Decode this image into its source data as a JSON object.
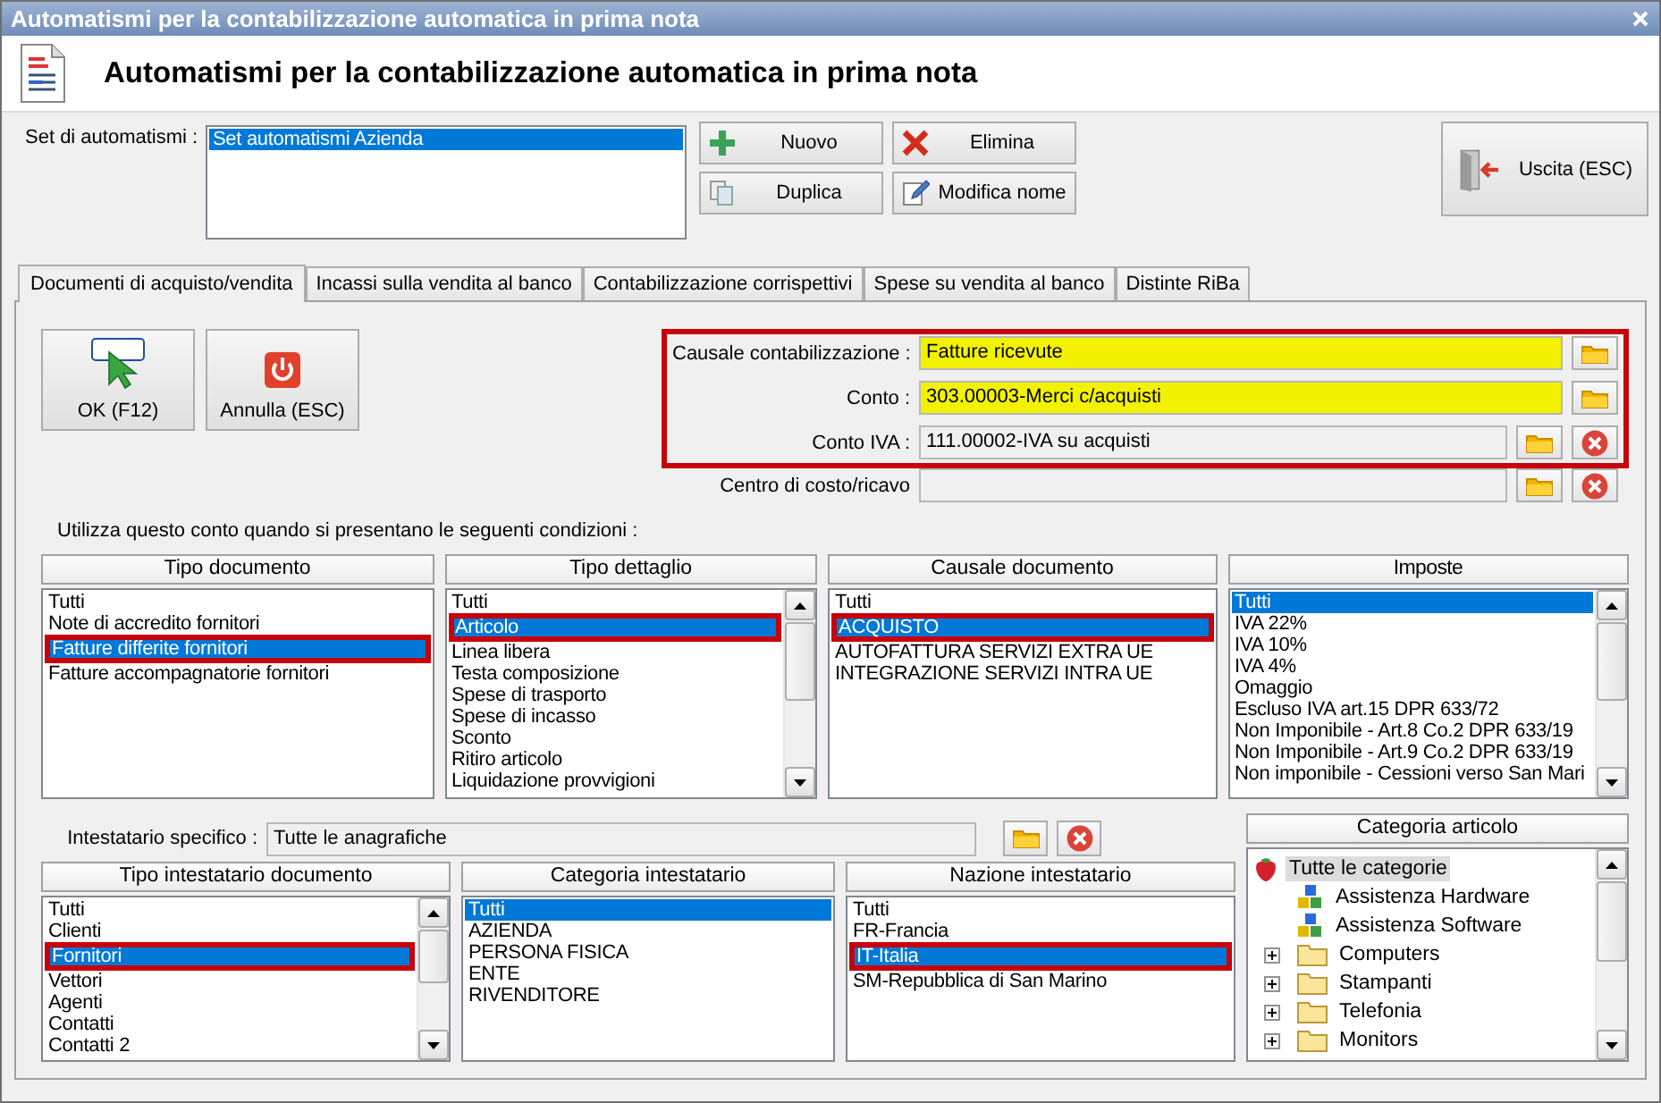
{
  "window": {
    "title": "Automatismi per la contabilizzazione automatica in prima nota"
  },
  "header": {
    "title": "Automatismi per la contabilizzazione automatica in prima nota"
  },
  "automation_sets": {
    "label": "Set di automatismi :",
    "items": [
      {
        "label": "Set automatismi Azienda",
        "selected": true
      }
    ]
  },
  "set_buttons": [
    "Nuovo",
    "Elimina",
    "Duplica",
    "Modifica nome"
  ],
  "exit_button": "Uscita (ESC)",
  "tabs": [
    {
      "label": "Documenti di acquisto/vendita",
      "selected": true
    },
    {
      "label": "Incassi sulla vendita al banco",
      "selected": false
    },
    {
      "label": "Contabilizzazione corrispettivi",
      "selected": false
    },
    {
      "label": "Spese su vendita al banco",
      "selected": false
    },
    {
      "label": "Distinte RiBa",
      "selected": false
    }
  ],
  "action_buttons": [
    "OK (F12)",
    "Annulla (ESC)"
  ],
  "account_fields": {
    "highlighted": true,
    "fields": [
      {
        "label": "Causale contabilizzazione :",
        "value": "Fatture ricevute",
        "required": true,
        "clearable": false
      },
      {
        "label": "Conto :",
        "value": "303.00003-Merci c/acquisti",
        "required": true,
        "clearable": false
      },
      {
        "label": "Conto IVA :",
        "value": "111.00002-IVA su acquisti",
        "required": false,
        "clearable": true
      }
    ]
  },
  "cost_center_field": {
    "label": "Centro di costo/ricavo",
    "required": false,
    "clearable": true
  },
  "conditions_label": "Utilizza questo conto quando si presentano le seguenti condizioni :",
  "condition_lists": [
    {
      "title": "Tipo documento",
      "scrollbar": false,
      "items": [
        {
          "label": "Tutti",
          "selected": false,
          "highlighted": false
        },
        {
          "label": "Note di accredito fornitori",
          "selected": false,
          "highlighted": false
        },
        {
          "label": "Fatture differite fornitori",
          "selected": true,
          "highlighted": true
        },
        {
          "label": "Fatture accompagnatorie fornitori",
          "selected": false,
          "highlighted": false
        }
      ]
    },
    {
      "title": "Tipo dettaglio",
      "scrollbar": true,
      "items": [
        {
          "label": "Tutti",
          "selected": false,
          "highlighted": false
        },
        {
          "label": "Articolo",
          "selected": true,
          "highlighted": true
        },
        {
          "label": "Linea libera",
          "selected": false,
          "highlighted": false
        },
        {
          "label": "Testa composizione",
          "selected": false,
          "highlighted": false
        },
        {
          "label": "Spese di trasporto",
          "selected": false,
          "highlighted": false
        },
        {
          "label": "Spese di incasso",
          "selected": false,
          "highlighted": false
        },
        {
          "label": "Sconto",
          "selected": false,
          "highlighted": false
        },
        {
          "label": "Ritiro articolo",
          "selected": false,
          "highlighted": false
        },
        {
          "label": "Liquidazione provvigioni",
          "selected": false,
          "highlighted": false
        }
      ]
    },
    {
      "title": "Causale documento",
      "scrollbar": false,
      "items": [
        {
          "label": "Tutti",
          "selected": false,
          "highlighted": false
        },
        {
          "label": "ACQUISTO",
          "selected": true,
          "highlighted": true
        },
        {
          "label": "AUTOFATTURA SERVIZI EXTRA UE",
          "selected": false,
          "highlighted": false
        },
        {
          "label": "INTEGRAZIONE SERVIZI INTRA UE",
          "selected": false,
          "highlighted": false
        }
      ]
    },
    {
      "title": "Imposte",
      "scrollbar": true,
      "items": [
        {
          "label": "Tutti",
          "selected": true,
          "highlighted": false
        },
        {
          "label": "IVA 22%",
          "selected": false,
          "highlighted": false
        },
        {
          "label": "IVA 10%",
          "selected": false,
          "highlighted": false
        },
        {
          "label": "IVA 4%",
          "selected": false,
          "highlighted": false
        },
        {
          "label": "Omaggio",
          "selected": false,
          "highlighted": false
        },
        {
          "label": "Escluso IVA art.15 DPR 633/72",
          "selected": false,
          "highlighted": false
        },
        {
          "label": "Non Imponibile - Art.8 Co.2 DPR 633/19",
          "selected": false,
          "highlighted": false
        },
        {
          "label": "Non Imponibile - Art.9 Co.2 DPR 633/19",
          "selected": false,
          "highlighted": false
        },
        {
          "label": "Non imponibile - Cessioni verso San Mari",
          "selected": false,
          "highlighted": false
        }
      ]
    }
  ],
  "holder_field": {
    "label": "Intestatario specifico :",
    "value": "Tutte le anagrafiche"
  },
  "holder_lists": [
    {
      "title": "Tipo intestatario documento",
      "scrollbar": true,
      "items": [
        {
          "label": "Tutti",
          "selected": false,
          "highlighted": false
        },
        {
          "label": "Clienti",
          "selected": false,
          "highlighted": false
        },
        {
          "label": "Fornitori",
          "selected": true,
          "highlighted": true
        },
        {
          "label": "Vettori",
          "selected": false,
          "highlighted": false
        },
        {
          "label": "Agenti",
          "selected": false,
          "highlighted": false
        },
        {
          "label": "Contatti",
          "selected": false,
          "highlighted": false
        },
        {
          "label": "Contatti 2",
          "selected": false,
          "highlighted": false
        }
      ]
    },
    {
      "title": "Categoria intestatario",
      "scrollbar": false,
      "items": [
        {
          "label": "Tutti",
          "selected": true,
          "highlighted": false
        },
        {
          "label": "AZIENDA",
          "selected": false,
          "highlighted": false
        },
        {
          "label": "PERSONA FISICA",
          "selected": false,
          "highlighted": false
        },
        {
          "label": "ENTE",
          "selected": false,
          "highlighted": false
        },
        {
          "label": "RIVENDITORE",
          "selected": false,
          "highlighted": false
        }
      ]
    },
    {
      "title": "Nazione intestatario",
      "scrollbar": false,
      "items": [
        {
          "label": "Tutti",
          "selected": false,
          "highlighted": false
        },
        {
          "label": "FR-Francia",
          "selected": false,
          "highlighted": false
        },
        {
          "label": "IT-Italia",
          "selected": true,
          "highlighted": true
        },
        {
          "label": "SM-Repubblica di San Marino",
          "selected": false,
          "highlighted": false
        }
      ]
    }
  ],
  "article_categories": {
    "title": "Categoria articolo",
    "scrollbar": true,
    "tree": [
      {
        "label": "Tutte le categorie",
        "kind": "root",
        "selected": true,
        "children": [
          {
            "label": "Assistenza Hardware",
            "kind": "service",
            "selected": false
          },
          {
            "label": "Assistenza Software",
            "kind": "service",
            "selected": false
          },
          {
            "label": "Computers",
            "kind": "folder",
            "selected": false,
            "expanded": false
          },
          {
            "label": "Stampanti",
            "kind": "folder",
            "selected": false,
            "expanded": false
          },
          {
            "label": "Telefonia",
            "kind": "folder",
            "selected": false,
            "expanded": false
          },
          {
            "label": "Monitors",
            "kind": "folder",
            "selected": false,
            "expanded": false
          }
        ]
      }
    ]
  }
}
